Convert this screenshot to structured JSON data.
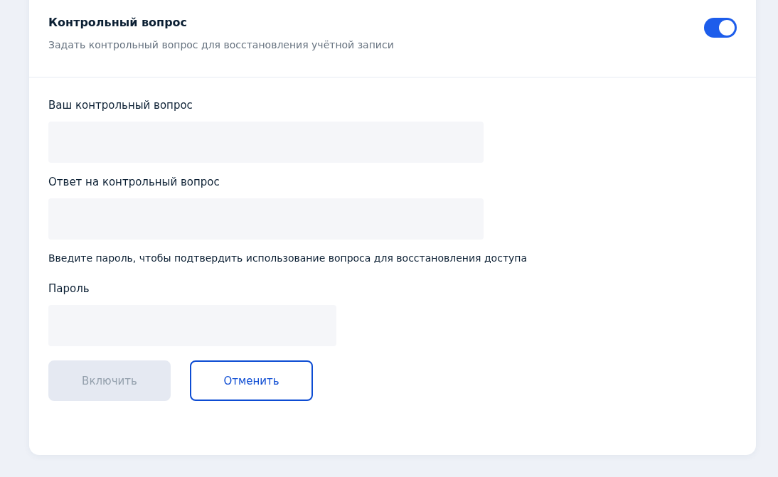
{
  "header": {
    "title": "Контрольный вопрос",
    "subtitle": "Задать контрольный вопрос для восстановления учётной записи",
    "toggle": {
      "on": true
    }
  },
  "question_fields": [
    {
      "label": "Ваш контрольный вопрос"
    },
    {
      "label": "Ответ на контрольный вопрос"
    }
  ],
  "password_note": "Введите пароль, чтобы подтвердить использование вопроса для восстановления доступа",
  "password_field": {
    "label": "Пароль"
  },
  "buttons": [
    {
      "label": "Включить",
      "kind": "primary",
      "disabled": true
    },
    {
      "label": "Отменить",
      "kind": "secondary",
      "disabled": false
    }
  ]
}
